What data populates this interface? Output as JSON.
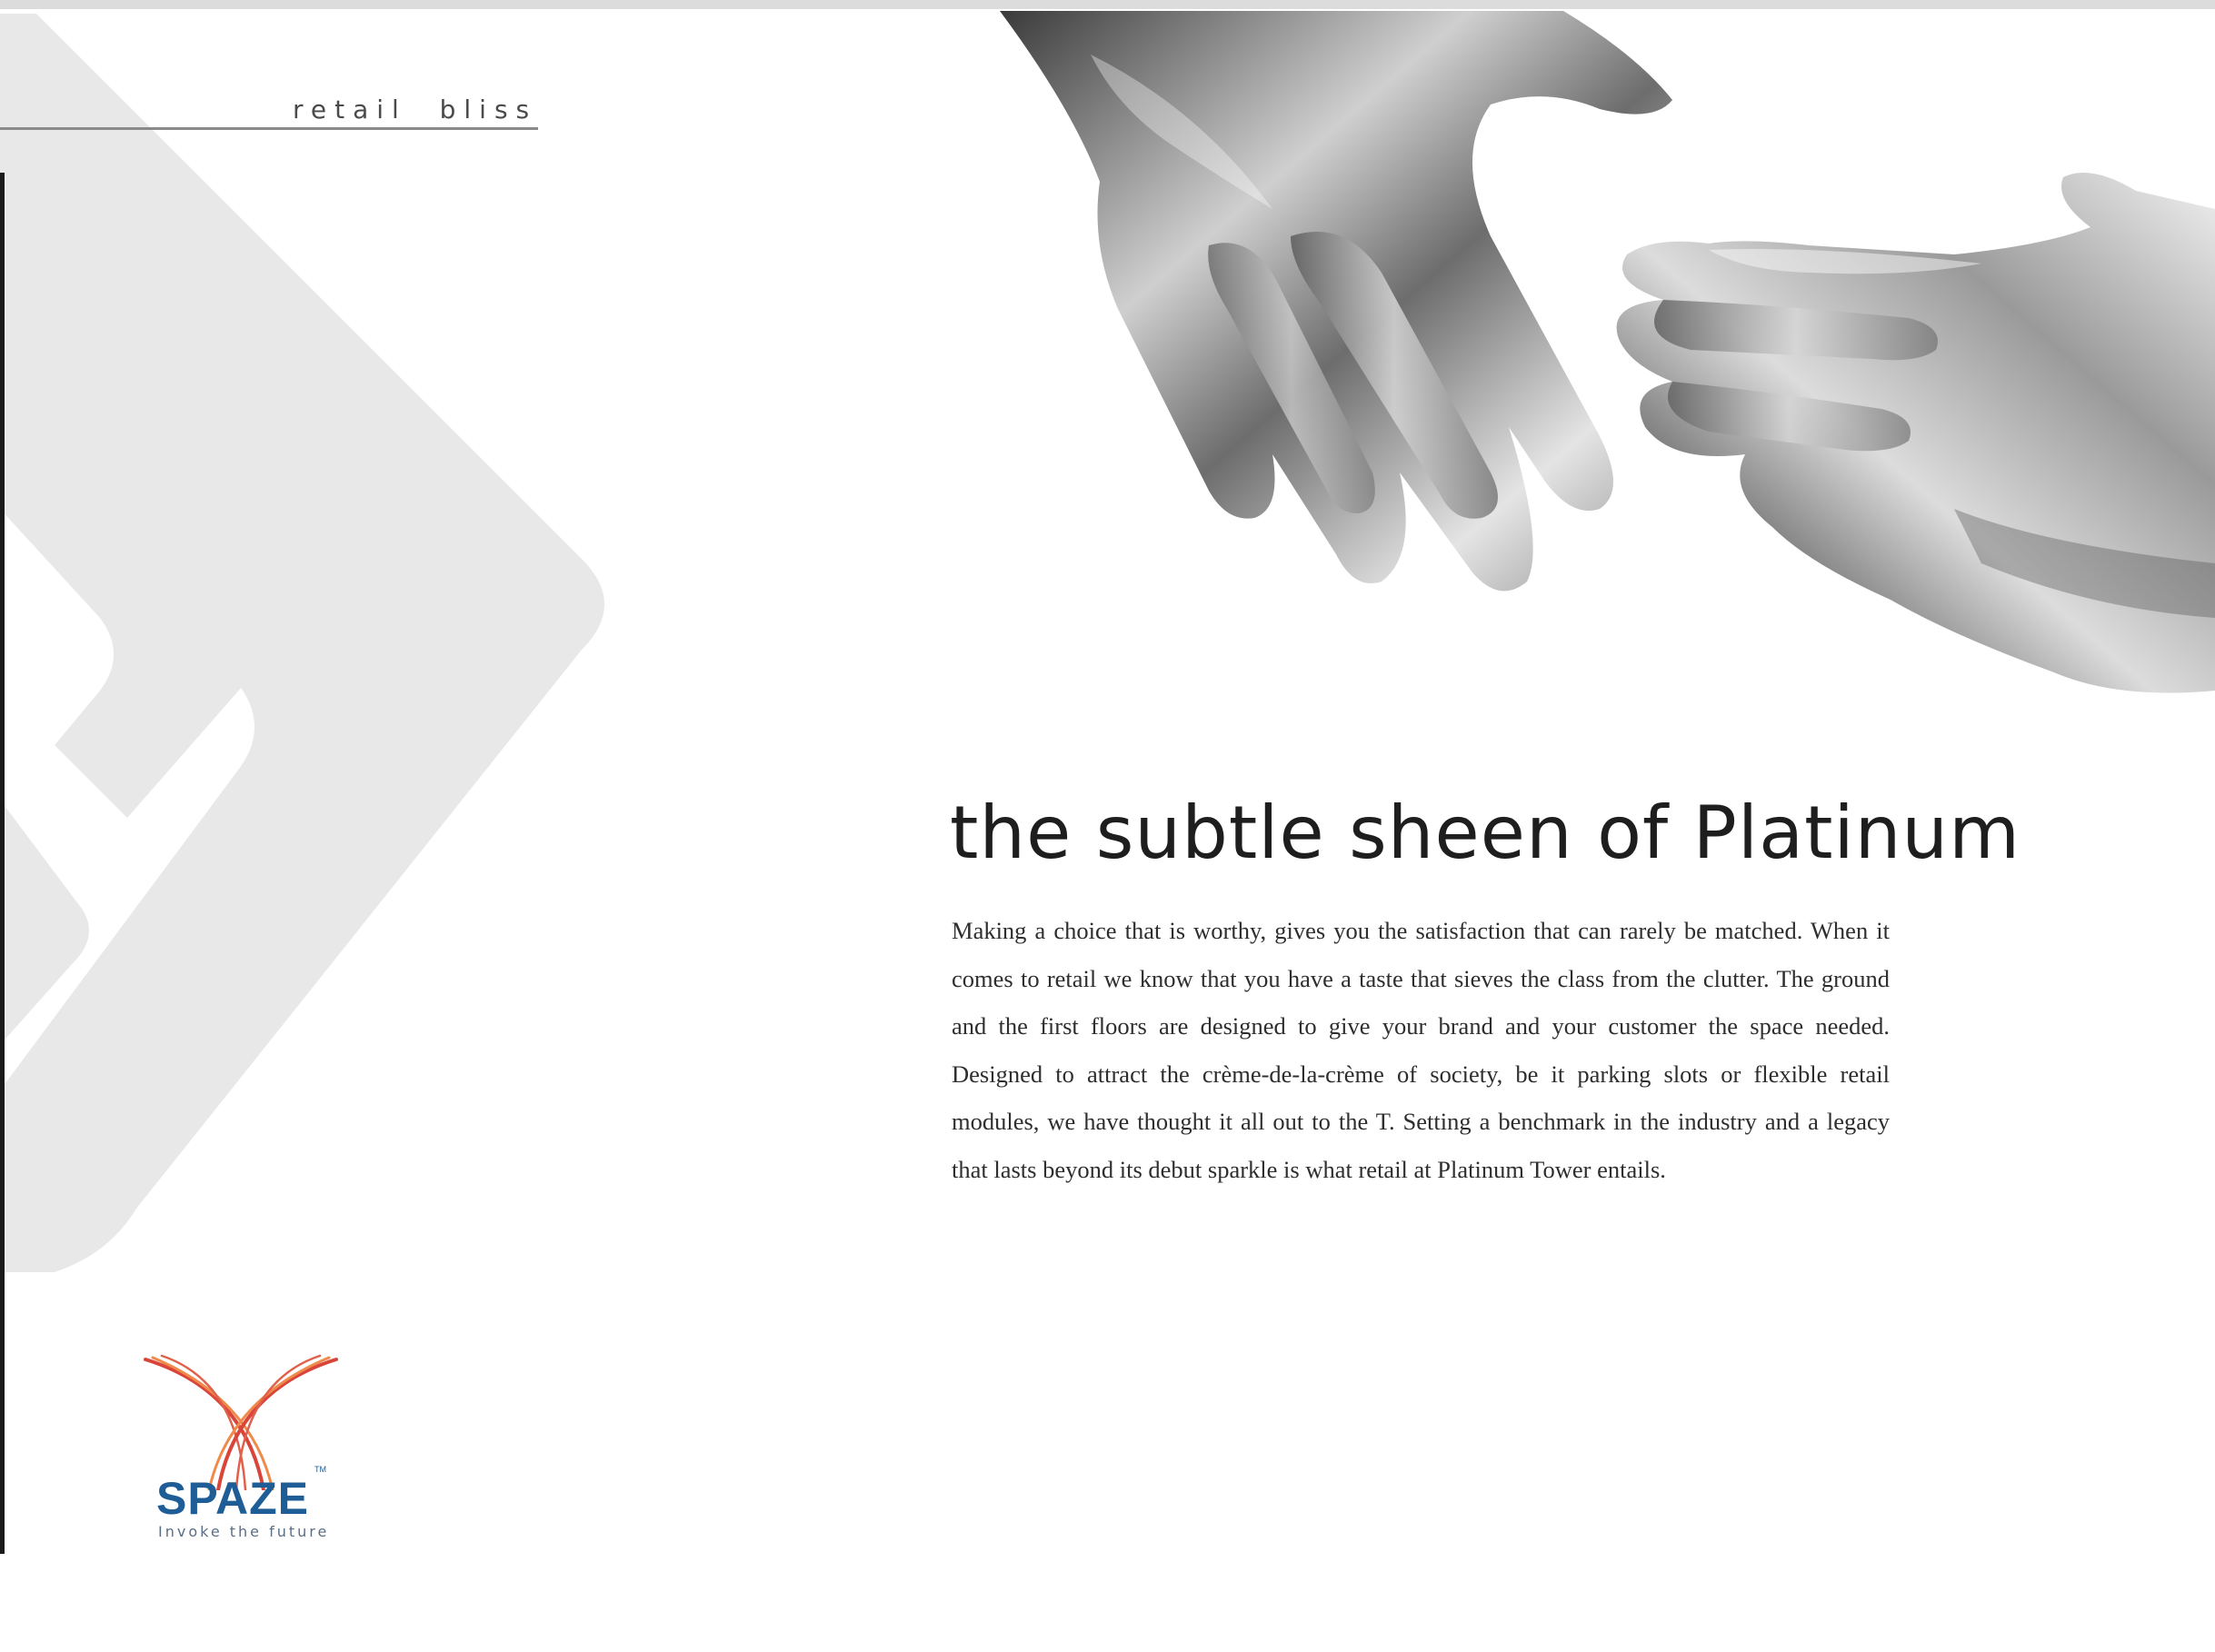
{
  "section_label": "retail  bliss",
  "headline": "the subtle sheen of Platinum",
  "body": "Making a choice that is worthy, gives you the satisfaction that can rarely be matched. When it comes to retail we know that you have a taste that sieves the class from the clutter. The ground and the first floors are designed to give your brand and your customer the space needed. Designed to attract the crème-de-la-crème of society, be it parking slots or flexible retail modules, we have thought it all out to the T. Setting a benchmark in the industry and a legacy that lasts beyond its debut sparkle is what retail at Platinum Tower entails.",
  "logo": {
    "wordmark": "SPAZE",
    "tm": "TM",
    "tagline": "Invoke the future"
  },
  "colors": {
    "decor_grey": "#e8e8e8",
    "logo_blue": "#1f5d96",
    "logo_red": "#d9453a",
    "logo_orange": "#f08a4b"
  },
  "icons": {
    "decor": "chevron-shapes",
    "image": "chrome-hands-reaching",
    "logo_mark": "crossed-arcs-logo"
  }
}
